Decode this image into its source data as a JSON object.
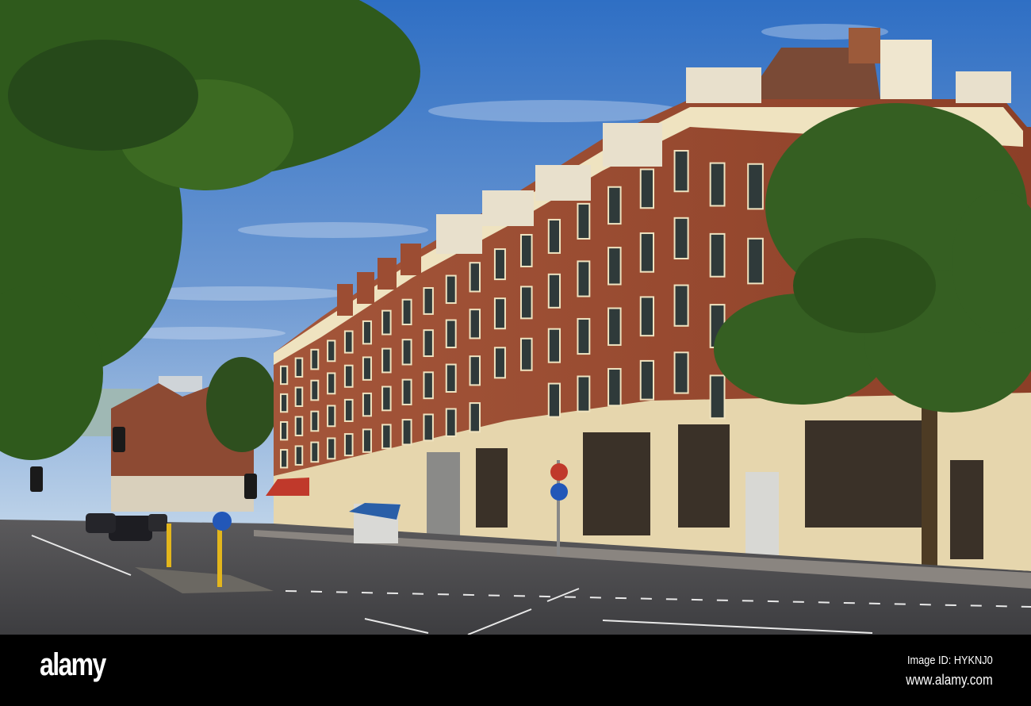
{
  "photo": {
    "subject": "street-scene",
    "colors": {
      "sky_top": "#2f6fc4",
      "sky_bottom": "#b4cde8",
      "brick": "#9a4a30",
      "cream": "#efe3c0",
      "road": "#4b4b4e",
      "foliage": "#2f5a1c"
    }
  },
  "watermark_bar": {
    "logo": "alamy",
    "image_id": "Image ID: HYKNJ0",
    "site": "www.alamy.com"
  }
}
